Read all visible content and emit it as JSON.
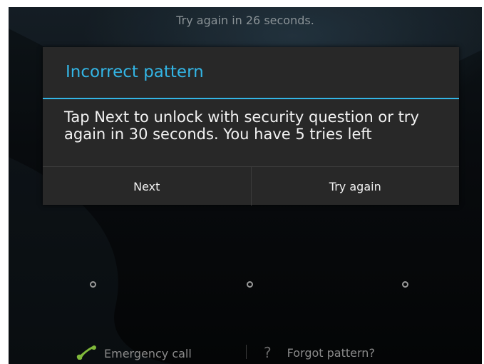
{
  "lockscreen": {
    "countdown_text": "Try again in 26 seconds."
  },
  "dialog": {
    "title": "Incorrect pattern",
    "message": "Tap Next to unlock with security question or try again in 30 seconds. You have 5 tries left",
    "buttons": {
      "next_label": "Next",
      "try_again_label": "Try again"
    }
  },
  "bottom_bar": {
    "emergency_call_label": "Emergency call",
    "forgot_pattern_label": "Forgot pattern?",
    "forgot_icon_glyph": "?"
  },
  "icons": {
    "emergency": "phone-icon",
    "forgot": "question-icon"
  },
  "colors": {
    "accent": "#33b5e5",
    "dialog_background": "#282828",
    "emergency_icon": "#7fb83a"
  }
}
